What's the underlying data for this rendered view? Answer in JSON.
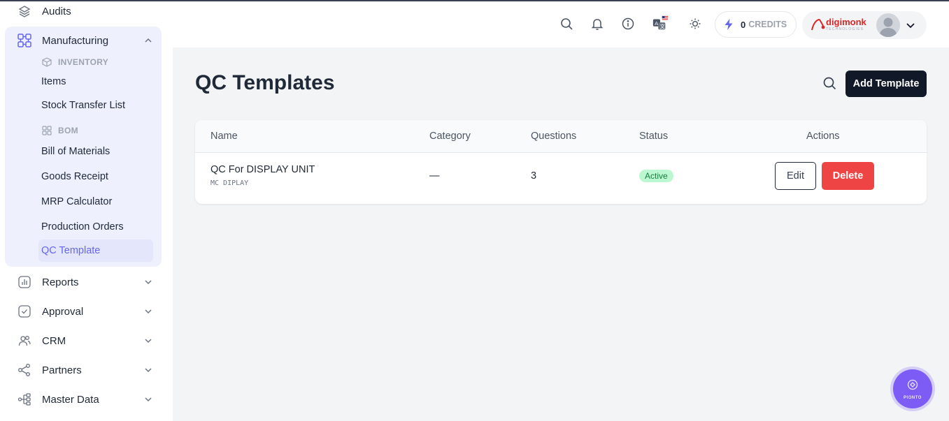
{
  "sidebar": {
    "audits": "Audits",
    "manufacturing": "Manufacturing",
    "inventory_heading": "INVENTORY",
    "items": "Items",
    "stock_transfer": "Stock Transfer List",
    "bom_heading": "BOM",
    "bill_of_materials": "Bill of Materials",
    "goods_receipt": "Goods Receipt",
    "mrp_calculator": "MRP Calculator",
    "production_orders": "Production Orders",
    "qc_template": "QC Template",
    "reports": "Reports",
    "approval": "Approval",
    "crm": "CRM",
    "partners": "Partners",
    "master_data": "Master Data"
  },
  "header": {
    "credits_count": "0",
    "credits_label": "CREDITS",
    "logo_text": "digimonk",
    "logo_sub": "TECHNOLOGIES"
  },
  "main": {
    "title": "QC Templates",
    "add_button": "Add Template",
    "columns": {
      "name": "Name",
      "category": "Category",
      "questions": "Questions",
      "status": "Status",
      "actions": "Actions"
    },
    "rows": [
      {
        "name": "QC For DISPLAY UNIT",
        "code": "MC DIPLAY",
        "category": "—",
        "questions": "3",
        "status": "Active",
        "edit": "Edit",
        "delete": "Delete"
      }
    ]
  },
  "fab": {
    "label": "PIONTO"
  },
  "colors": {
    "accent": "#6366f1",
    "primary_dark": "#111827",
    "danger": "#ef4444",
    "success_bg": "#bbf7d0",
    "success_text": "#15803d"
  }
}
